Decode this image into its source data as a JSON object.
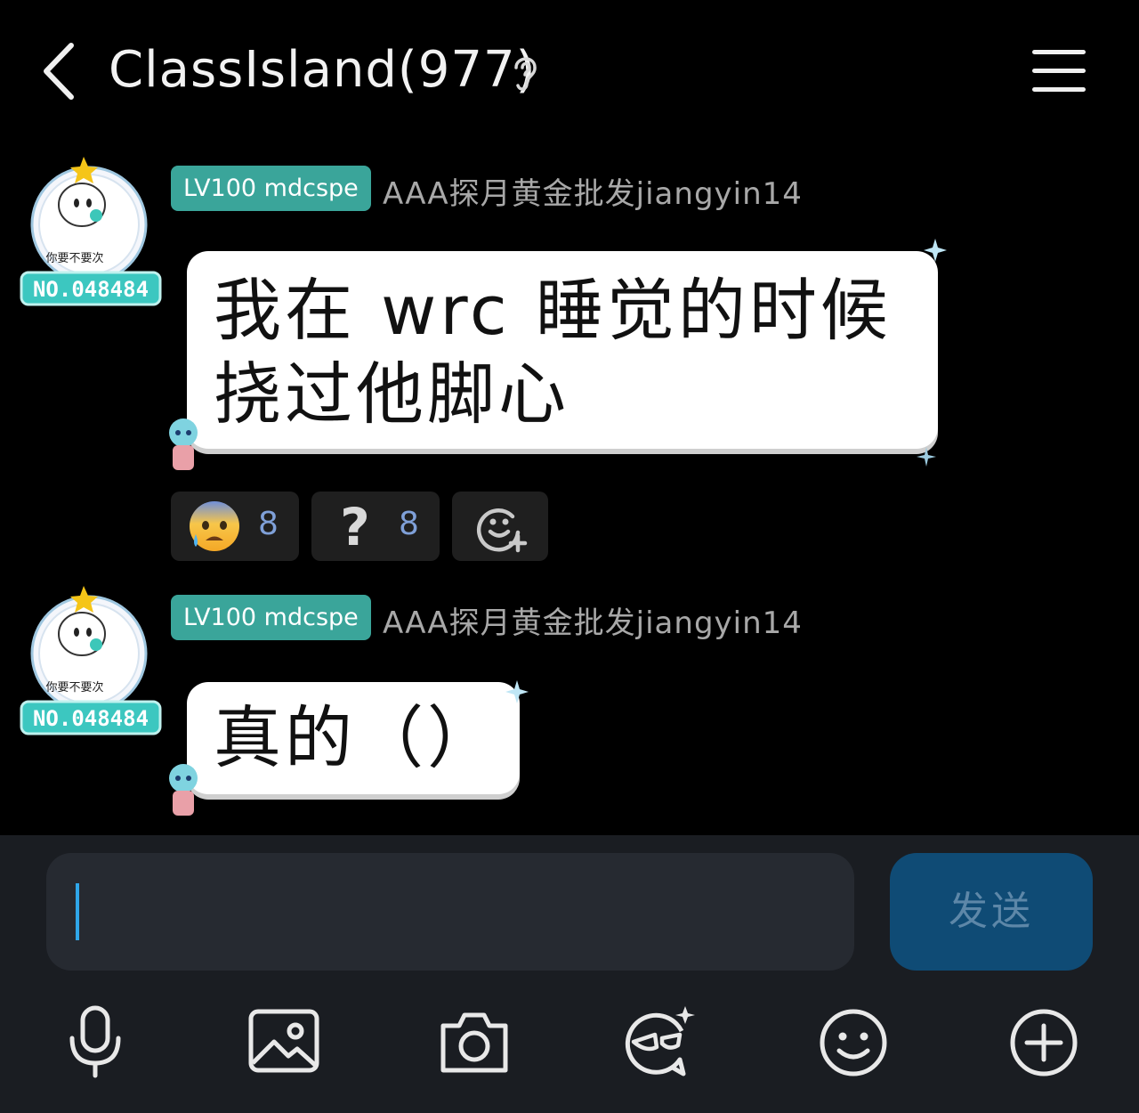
{
  "header": {
    "title": "ClassIsland(977)",
    "back_icon": "chevron-left-icon",
    "ear_icon": "ear-icon",
    "menu_icon": "hamburger-menu-icon"
  },
  "messages": [
    {
      "badge": "LV100 mdcspe",
      "username": "AAA探月黄金批发jiangyin14",
      "avatar_caption": "你要不要次",
      "avatar_number": "NO.048484",
      "text": "我在 wrc 睡觉的时候\n挠过他脚心",
      "reactions": [
        {
          "emoji": "anxious-face-with-sweat",
          "count": "8"
        },
        {
          "emoji": "question-mark",
          "count": "8"
        },
        {
          "emoji": "add-reaction-icon",
          "count": ""
        }
      ]
    },
    {
      "badge": "LV100 mdcspe",
      "username": "AAA探月黄金批发jiangyin14",
      "avatar_caption": "你要不要次",
      "avatar_number": "NO.048484",
      "text": "真的（）"
    }
  ],
  "composer": {
    "input_value": "",
    "send_label": "发送",
    "tools": [
      "microphone-icon",
      "image-icon",
      "camera-icon",
      "sticker-face-icon",
      "emoji-icon",
      "plus-circle-icon"
    ]
  },
  "colors": {
    "background": "#000000",
    "badge": "#3aa59a",
    "send_button": "#0f4b75",
    "caret": "#2fa7ea",
    "reaction_count": "#7fa0d8"
  }
}
